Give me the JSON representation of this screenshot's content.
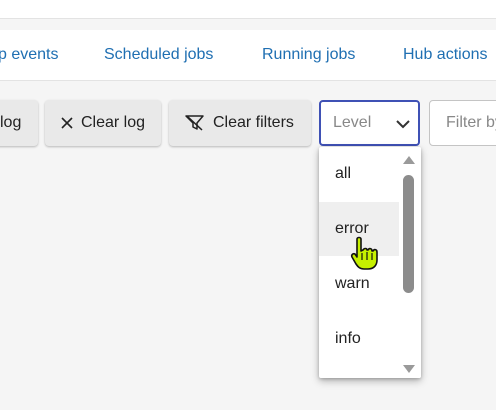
{
  "tabs": [
    {
      "label": "p events"
    },
    {
      "label": "Scheduled jobs"
    },
    {
      "label": "Running jobs"
    },
    {
      "label": "Hub actions"
    }
  ],
  "toolbar": {
    "partial_button_label": "log",
    "clear_log_label": "Clear log",
    "clear_filters_label": "Clear filters"
  },
  "level_select": {
    "placeholder": "Level",
    "options": [
      "all",
      "error",
      "warn",
      "info"
    ],
    "hovered_option": "error"
  },
  "filter_input": {
    "placeholder": "Filter by"
  },
  "colors": {
    "link": "#1f6fb2",
    "focus_border": "#3f51b5",
    "cursor_fill": "#c6f000"
  },
  "icons": [
    "close-icon",
    "filter-off-icon",
    "chevron-down-icon",
    "scroll-up-arrow-icon",
    "scroll-down-arrow-icon",
    "hand-pointer-cursor-icon"
  ]
}
